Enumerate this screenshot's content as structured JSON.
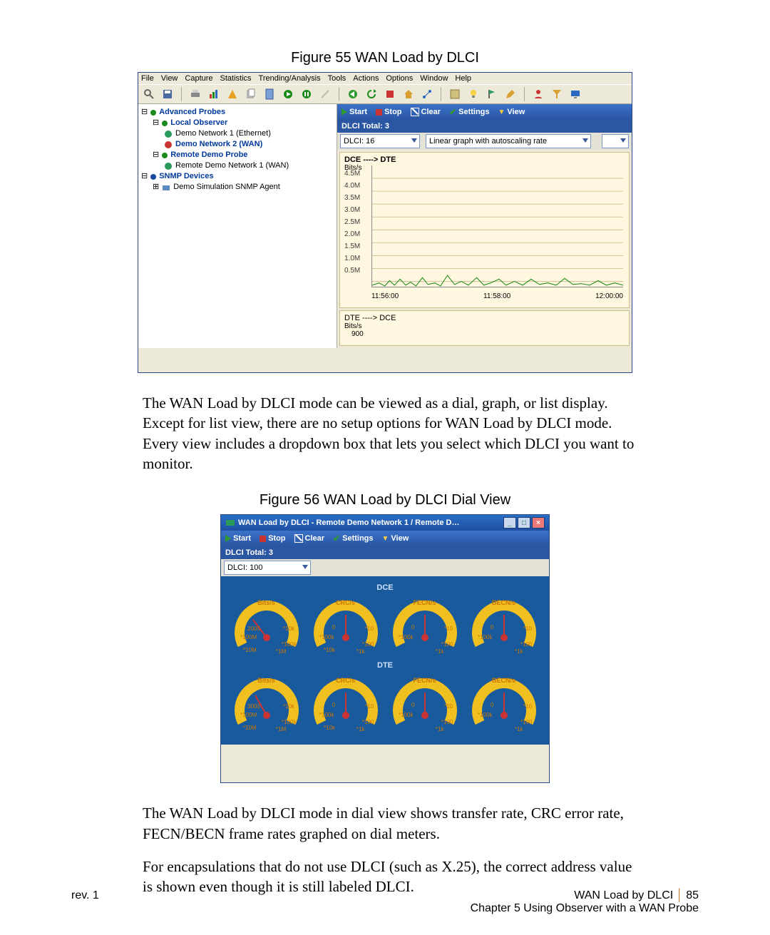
{
  "figure55": {
    "caption": "Figure 55  WAN Load by DLCI"
  },
  "win1": {
    "menubar": [
      "File",
      "View",
      "Capture",
      "Statistics",
      "Trending/Analysis",
      "Tools",
      "Actions",
      "Options",
      "Window",
      "Help"
    ],
    "tree": {
      "advanced_probes": "Advanced Probes",
      "local_observer": "Local Observer",
      "demo_net1": "Demo Network 1 (Ethernet)",
      "demo_net2": "Demo Network 2 (WAN)",
      "remote_probe": "Remote Demo Probe",
      "remote_net1": "Remote Demo Network 1 (WAN)",
      "snmp_devices": "SNMP Devices",
      "snmp_agent": "Demo Simulation SNMP Agent"
    },
    "actions": {
      "start": "Start",
      "stop": "Stop",
      "clear": "Clear",
      "settings": "Settings",
      "view": "View"
    },
    "dlci_total_label": "DLCI Total:",
    "dlci_total_value": "3",
    "dlci_sel": "DLCI: 16",
    "graph_type": "Linear graph with autoscaling rate",
    "chart1_title": "DCE ----> DTE",
    "chart1_units": "Bits/s",
    "chart2_title": "DTE ----> DCE",
    "chart2_units": "Bits/s",
    "chart2_tick": "900"
  },
  "chart_data": {
    "type": "line",
    "x": [
      "11:56:00",
      "11:58:00",
      "12:00:00"
    ],
    "ylabel": "Bits/s",
    "ylim": [
      0,
      4500000
    ],
    "yticks_labels": [
      "4.5M",
      "4.0M",
      "3.5M",
      "3.0M",
      "2.5M",
      "2.0M",
      "1.5M",
      "1.0M",
      "0.5M"
    ],
    "series": [
      {
        "name": "DCE to DTE",
        "note": "noisy low-amplitude signal roughly 0–0.3M across span"
      }
    ]
  },
  "para1": "The WAN Load by DLCI mode can be viewed as a dial, graph, or list display. Except for list view, there are no setup options for WAN Load by DLCI mode. Every view includes a dropdown box that lets you select which DLCI you want to monitor.",
  "figure56": {
    "caption": "Figure 56  WAN Load by DLCI Dial View"
  },
  "win2": {
    "title": "WAN Load by DLCI - Remote Demo Network 1 / Remote D…",
    "dlci_total_label": "DLCI Total:",
    "dlci_total_value": "3",
    "dlci_sel": "DLCI: 100",
    "sections": {
      "dce": "DCE",
      "dte": "DTE"
    },
    "gauges": {
      "bits": "Bits/s",
      "crc": "CRC/s",
      "fecn": "FECN/s",
      "becn": "BECN/s",
      "dce_bits_val": "2000",
      "dte_bits_val": "3000",
      "zero": "0",
      "tick_100M": "*100M",
      "tick_10k": "*10k",
      "tick_100k": "*100k",
      "tick_10M": "*10M",
      "tick_1M": "*1M",
      "tick_100k_s": "*100k",
      "tick_10": "*10",
      "tick_100": "*100",
      "tick_1k": "*1k",
      "tick_10k_s": "*10k"
    }
  },
  "para2": "The WAN Load by DLCI mode in dial view shows transfer rate, CRC error rate, FECN/BECN frame rates graphed on dial meters.",
  "para3": "For encapsulations that do not use DLCI (such as X.25), the correct address value is shown even though it is still labeled DLCI.",
  "footer": {
    "left": "rev. 1",
    "right_top": "WAN Load by DLCI",
    "page": "85",
    "right_bot": "Chapter 5 Using Observer with a WAN Probe"
  }
}
